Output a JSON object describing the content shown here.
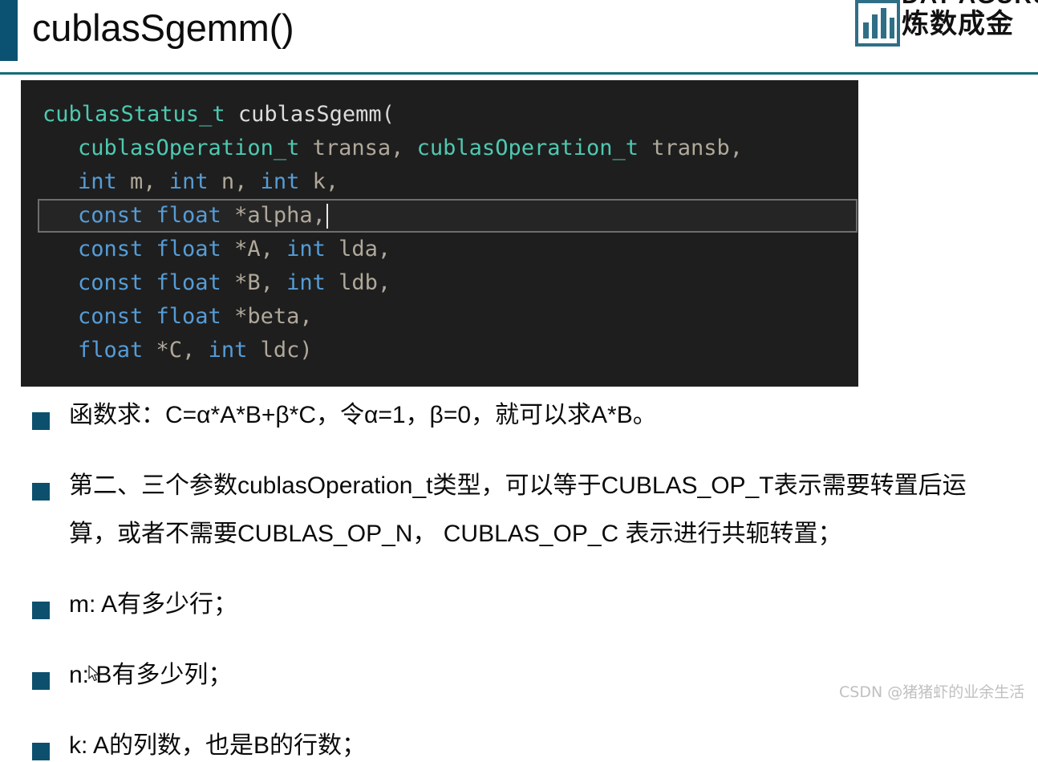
{
  "header": {
    "title": "cublasSgemm()",
    "accent_color": "#0b5272",
    "divider_color": "#106d77"
  },
  "logo": {
    "icon": "bar-chart-icon",
    "text_cn": "炼数成金",
    "text_en": "DAT AGURU",
    "bar_color": "#2f6f86"
  },
  "code_block": {
    "background": "#1e1e1e",
    "language": "c",
    "highlighted_line_index": 3,
    "caret_visible": true,
    "lines": [
      {
        "indent": 0,
        "tokens": [
          {
            "text": "cublasStatus_t ",
            "cls": "tok-type"
          },
          {
            "text": "cublasSgemm",
            "cls": "tok-fn"
          },
          {
            "text": "(",
            "cls": "tok-punct"
          }
        ]
      },
      {
        "indent": 1,
        "tokens": [
          {
            "text": "cublasOperation_t ",
            "cls": "tok-type"
          },
          {
            "text": "transa, ",
            "cls": "tok-var"
          },
          {
            "text": "cublasOperation_t ",
            "cls": "tok-type"
          },
          {
            "text": "transb,",
            "cls": "tok-var"
          }
        ]
      },
      {
        "indent": 1,
        "tokens": [
          {
            "text": "int ",
            "cls": "tok-kw"
          },
          {
            "text": "m, ",
            "cls": "tok-var"
          },
          {
            "text": "int ",
            "cls": "tok-kw"
          },
          {
            "text": "n, ",
            "cls": "tok-var"
          },
          {
            "text": "int ",
            "cls": "tok-kw"
          },
          {
            "text": "k,",
            "cls": "tok-var"
          }
        ]
      },
      {
        "indent": 1,
        "tokens": [
          {
            "text": "const float ",
            "cls": "tok-kw"
          },
          {
            "text": "*alpha,",
            "cls": "tok-var"
          }
        ]
      },
      {
        "indent": 1,
        "tokens": [
          {
            "text": "const float ",
            "cls": "tok-kw"
          },
          {
            "text": "*A, ",
            "cls": "tok-var"
          },
          {
            "text": "int ",
            "cls": "tok-kw"
          },
          {
            "text": "lda,",
            "cls": "tok-var"
          }
        ]
      },
      {
        "indent": 1,
        "tokens": [
          {
            "text": "const float ",
            "cls": "tok-kw"
          },
          {
            "text": "*B, ",
            "cls": "tok-var"
          },
          {
            "text": "int ",
            "cls": "tok-kw"
          },
          {
            "text": "ldb,",
            "cls": "tok-var"
          }
        ]
      },
      {
        "indent": 1,
        "tokens": [
          {
            "text": "const float ",
            "cls": "tok-kw"
          },
          {
            "text": "*beta,",
            "cls": "tok-var"
          }
        ]
      },
      {
        "indent": 1,
        "tokens": [
          {
            "text": "float ",
            "cls": "tok-kw"
          },
          {
            "text": "*C, ",
            "cls": "tok-var"
          },
          {
            "text": "int ",
            "cls": "tok-kw"
          },
          {
            "text": "ldc)",
            "cls": "tok-var"
          }
        ]
      }
    ]
  },
  "bullets": {
    "marker_color": "#0c506e",
    "items": [
      {
        "lines": [
          "函数求：C=α*A*B+β*C，令α=1，β=0，就可以求A*B。"
        ]
      },
      {
        "lines": [
          "第二、三个参数cublasOperation_t类型，可以等于CUBLAS_OP_T表示需要转置后运",
          "算，或者不需要CUBLAS_OP_N， CUBLAS_OP_C 表示进行共轭转置；"
        ]
      },
      {
        "lines": [
          "m: A有多少行；"
        ]
      },
      {
        "lines": [
          "n: B有多少列；"
        ]
      },
      {
        "lines": [
          "k: A的列数，也是B的行数；"
        ]
      }
    ]
  },
  "watermark": {
    "text": "CSDN @猪猪虾的业余生活"
  }
}
